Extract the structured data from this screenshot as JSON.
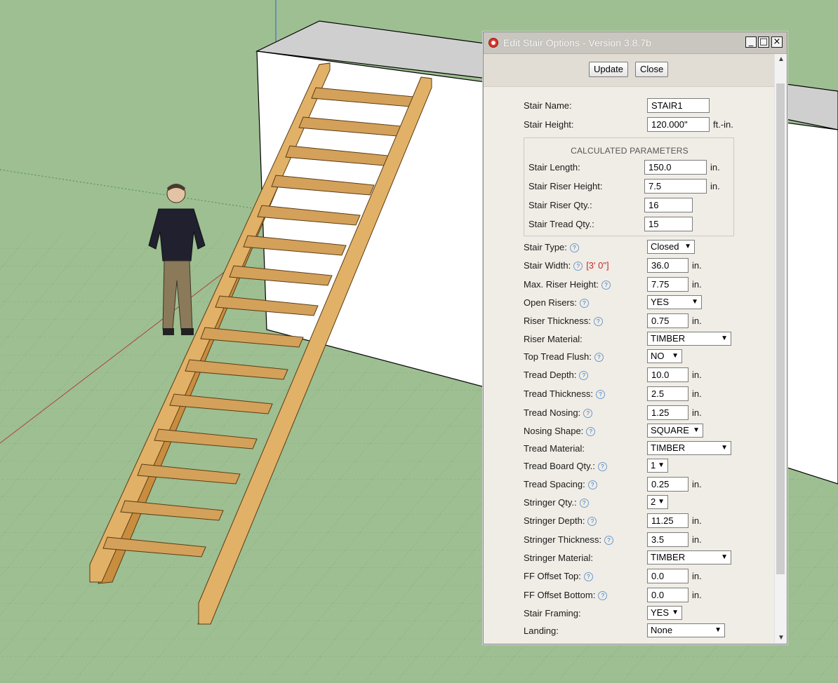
{
  "dialog": {
    "title": "Edit Stair Options - Version 3.8.7b",
    "minimize": "_",
    "maximize": "□",
    "close": "×",
    "update_label": "Update",
    "close_label": "Close"
  },
  "fields": {
    "stair_name": {
      "label": "Stair Name:",
      "value": "STAIR1"
    },
    "stair_height": {
      "label": "Stair Height:",
      "value": "120.000\"",
      "unit": "ft.-in."
    }
  },
  "calculated": {
    "title": "CALCULATED PARAMETERS",
    "rows": [
      {
        "label": "Stair Length:",
        "value": "150.0",
        "unit": "in."
      },
      {
        "label": "Stair Riser Height:",
        "value": "7.5",
        "unit": "in."
      },
      {
        "label": "Stair Riser Qty.:",
        "value": "16",
        "unit": ""
      },
      {
        "label": "Stair Tread Qty.:",
        "value": "15",
        "unit": ""
      }
    ]
  },
  "options": [
    {
      "label": "Stair Type:",
      "help": "?",
      "kind": "select",
      "value": "Closed"
    },
    {
      "label": "Stair Width:",
      "help": "?",
      "note": "[3' 0\"]",
      "kind": "input",
      "value": "36.0",
      "unit": "in."
    },
    {
      "label": "Max. Riser Height:",
      "help": "?",
      "kind": "input",
      "value": "7.75",
      "unit": "in."
    },
    {
      "label": "Open Risers:",
      "help": "?",
      "kind": "select",
      "value": "YES"
    },
    {
      "label": "Riser Thickness:",
      "help": "?",
      "kind": "input",
      "value": "0.75",
      "unit": "in."
    },
    {
      "label": "Riser Material:",
      "kind": "select",
      "value": "TIMBER"
    },
    {
      "label": "Top Tread Flush:",
      "help": "?",
      "kind": "select",
      "value": "NO"
    },
    {
      "label": "Tread Depth:",
      "help": "?",
      "kind": "input",
      "value": "10.0",
      "unit": "in."
    },
    {
      "label": "Tread Thickness:",
      "help": "?",
      "kind": "input",
      "value": "2.5",
      "unit": "in."
    },
    {
      "label": "Tread Nosing:",
      "help": "?",
      "kind": "input",
      "value": "1.25",
      "unit": "in."
    },
    {
      "label": "Nosing Shape:",
      "help": "?",
      "kind": "select",
      "value": "SQUARE"
    },
    {
      "label": "Tread Material:",
      "kind": "select",
      "value": "TIMBER"
    },
    {
      "label": "Tread Board Qty.:",
      "help": "?",
      "kind": "select",
      "value": "1"
    },
    {
      "label": "Tread Spacing:",
      "help": "?",
      "kind": "input",
      "value": "0.25",
      "unit": "in."
    },
    {
      "label": "Stringer Qty.:",
      "help": "?",
      "kind": "select",
      "value": "2"
    },
    {
      "label": "Stringer Depth:",
      "help": "?",
      "kind": "input",
      "value": "11.25",
      "unit": "in."
    },
    {
      "label": "Stringer Thickness:",
      "help": "?",
      "kind": "input",
      "value": "3.5",
      "unit": "in."
    },
    {
      "label": "Stringer Material:",
      "kind": "select",
      "value": "TIMBER"
    },
    {
      "label": "FF Offset Top:",
      "help": "?",
      "kind": "input",
      "value": "0.0",
      "unit": "in."
    },
    {
      "label": "FF Offset Bottom:",
      "help": "?",
      "kind": "input",
      "value": "0.0",
      "unit": "in."
    },
    {
      "label": "Stair Framing:",
      "kind": "select",
      "value": "YES"
    },
    {
      "label": "Landing:",
      "kind": "select",
      "value": "None"
    }
  ],
  "colors": {
    "ground": "#9bbd8f",
    "wall_top": "#c8c8c8",
    "wood": "#d9a85c",
    "note_red": "#c12c2c"
  }
}
